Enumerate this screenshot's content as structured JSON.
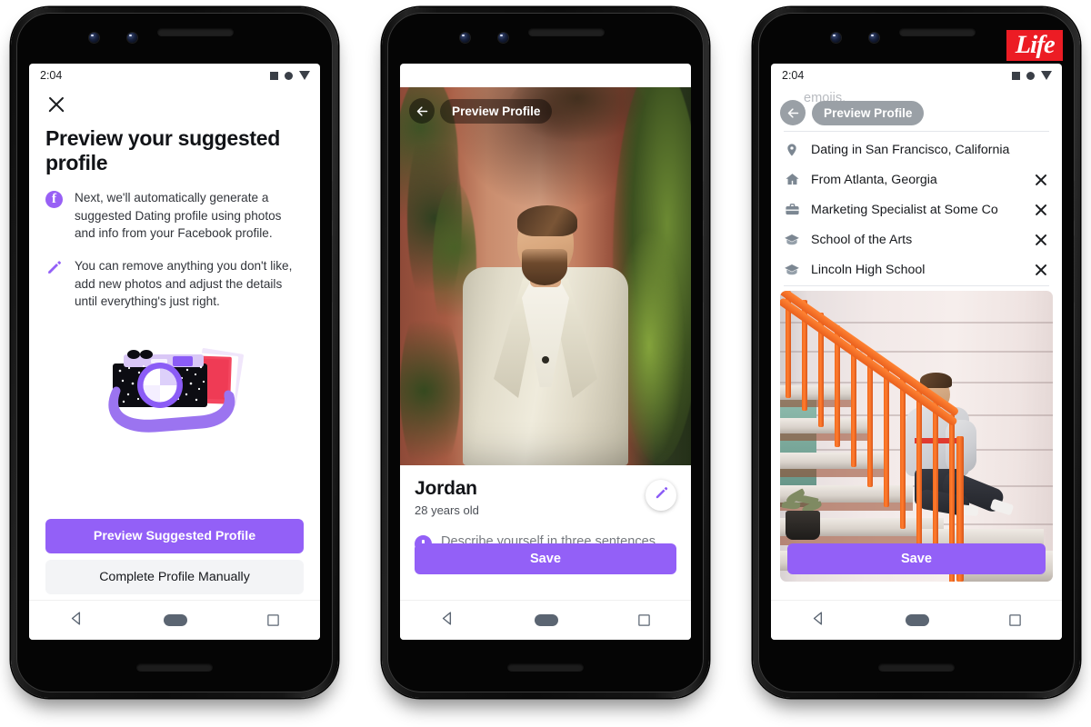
{
  "brand": {
    "logo_text": "Life",
    "logo_color": "#ec1c24"
  },
  "theme": {
    "accent": "#9360f7",
    "secondary_bg": "#f3f4f6"
  },
  "phone1": {
    "status": {
      "time": "2:04",
      "icons": [
        "square-icon",
        "circle-icon",
        "triangle-down-icon"
      ]
    },
    "close_icon": "close-icon",
    "title": "Preview your suggested profile",
    "bullets": [
      {
        "icon": "facebook-icon",
        "text": "Next, we'll automatically generate a suggested Dating profile using photos and info from your Facebook profile."
      },
      {
        "icon": "pencil-icon",
        "text": "You can remove anything you don't like, add new photos and adjust the details until everything's just right."
      }
    ],
    "illustration": "camera-with-photos-illustration",
    "primary_button": "Preview Suggested Profile",
    "secondary_button": "Complete Profile Manually",
    "navbar": {
      "back": "back-triangle-icon",
      "home": "home-pill-icon",
      "recents": "recents-square-icon"
    }
  },
  "phone2": {
    "status": {
      "time": "2:04"
    },
    "header": {
      "back_icon": "back-arrow-icon",
      "title": "Preview Profile"
    },
    "photo": "man-in-cream-blazer-photo",
    "profile": {
      "name": "Jordan",
      "age": "28 years old",
      "edit_icon": "pencil-icon"
    },
    "prompt": {
      "icon": "plus-icon",
      "text": "Describe yourself in three sentences, three words or three emojis."
    },
    "save_button": "Save"
  },
  "phone3": {
    "status": {
      "time": "2:04"
    },
    "ghost_text": "emojis.",
    "header": {
      "back_icon": "back-arrow-icon",
      "title": "Preview Profile"
    },
    "info_rows": [
      {
        "icon": "location-pin-icon",
        "label": "Dating in San Francisco, California",
        "removable": false
      },
      {
        "icon": "home-icon",
        "label": "From Atlanta, Georgia",
        "removable": true
      },
      {
        "icon": "briefcase-icon",
        "label": "Marketing Specialist at Some Co",
        "removable": true
      },
      {
        "icon": "graduation-cap-icon",
        "label": "School of the Arts",
        "removable": true
      },
      {
        "icon": "graduation-cap-icon",
        "label": "Lincoln High School",
        "removable": true
      }
    ],
    "photo": "man-on-orange-stairs-photo",
    "save_button": "Save"
  }
}
